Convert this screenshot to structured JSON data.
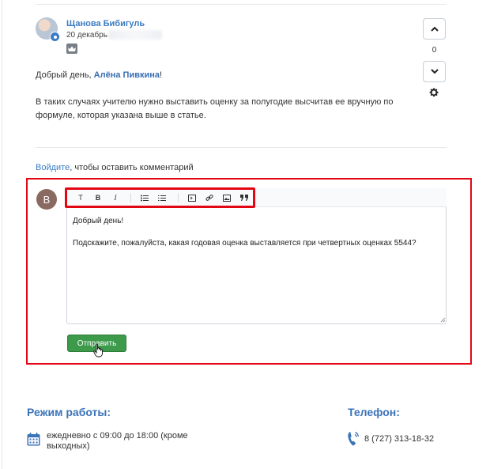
{
  "comment": {
    "author": "Щанова Бибигуль",
    "date": "20 декабрь",
    "greeting_prefix": "Добрый день, ",
    "greeting_name": "Алёна Пивкина",
    "greeting_suffix": "!",
    "body": "В таких случаях учителю нужно выставить оценку за полугодие высчитав ее вручную по формуле, которая указана выше в статье.",
    "vote_count": "0"
  },
  "login_prompt": {
    "link": "Войдите",
    "text": ", чтобы оставить комментарий"
  },
  "reply_form": {
    "avatar_letter": "В",
    "toolbar": [
      "T",
      "B",
      "I",
      "bulleted-list-icon",
      "numbered-list-icon",
      "code-icon",
      "link-icon",
      "image-icon",
      "quote-icon"
    ],
    "text_line1": "Добрый день!",
    "text_line2": "Подскажите, пожалуйста, какая годовая оценка выставляется при четвертных оценках 5544?",
    "submit_label": "Отправить"
  },
  "footer": {
    "hours_title": "Режим работы:",
    "hours_text": "ежедневно с 09:00 до 18:00 (кроме выходных)",
    "phone_title": "Телефон:",
    "phone_number": "8 (727) 313-18-32"
  },
  "colors": {
    "accent": "#3b7bc1",
    "highlight": "#e30613",
    "submit": "#3c9a4a"
  }
}
